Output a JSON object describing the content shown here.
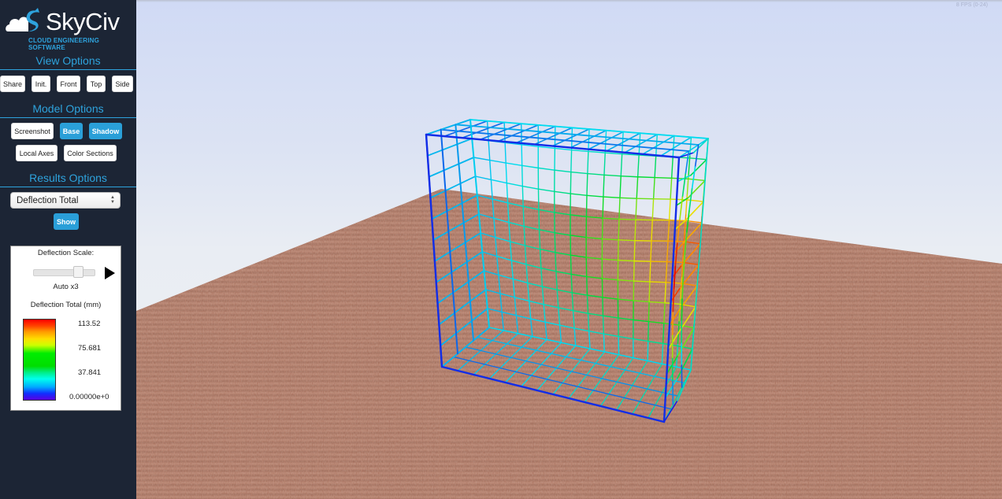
{
  "app": {
    "logo_text": "SkyCiv",
    "logo_subtitle": "CLOUD ENGINEERING SOFTWARE"
  },
  "view_options": {
    "title": "View Options",
    "buttons": [
      "Share",
      "Init.",
      "Front",
      "Top",
      "Side"
    ]
  },
  "model_options": {
    "title": "Model Options",
    "buttons": [
      {
        "label": "Screenshot",
        "active": false
      },
      {
        "label": "Base",
        "active": true
      },
      {
        "label": "Shadow",
        "active": true
      },
      {
        "label": "Local Axes",
        "active": false
      },
      {
        "label": "Color Sections",
        "active": false
      }
    ]
  },
  "results_options": {
    "title": "Results Options",
    "selected_result": "Deflection Total",
    "show_label": "Show"
  },
  "legend": {
    "scale_label": "Deflection Scale:",
    "scale_value_label": "Auto x3",
    "scale_slider_fraction": 0.8,
    "result_title": "Deflection Total (mm)",
    "ticks": [
      "113.52",
      "75.681",
      "37.841",
      "0.00000e+0"
    ],
    "max_value": 113.52,
    "min_value": 0
  },
  "viewport": {
    "fps_text": "8 FPS (0-24)",
    "colors": {
      "ground": "#a8725f",
      "sky_top": "#d0daf5",
      "sky_bottom": "#edf0f4"
    }
  },
  "colors": {
    "sidebar_bg": "#1c2535",
    "accent": "#2ea3dd",
    "active_button": "#2a9fd8"
  }
}
